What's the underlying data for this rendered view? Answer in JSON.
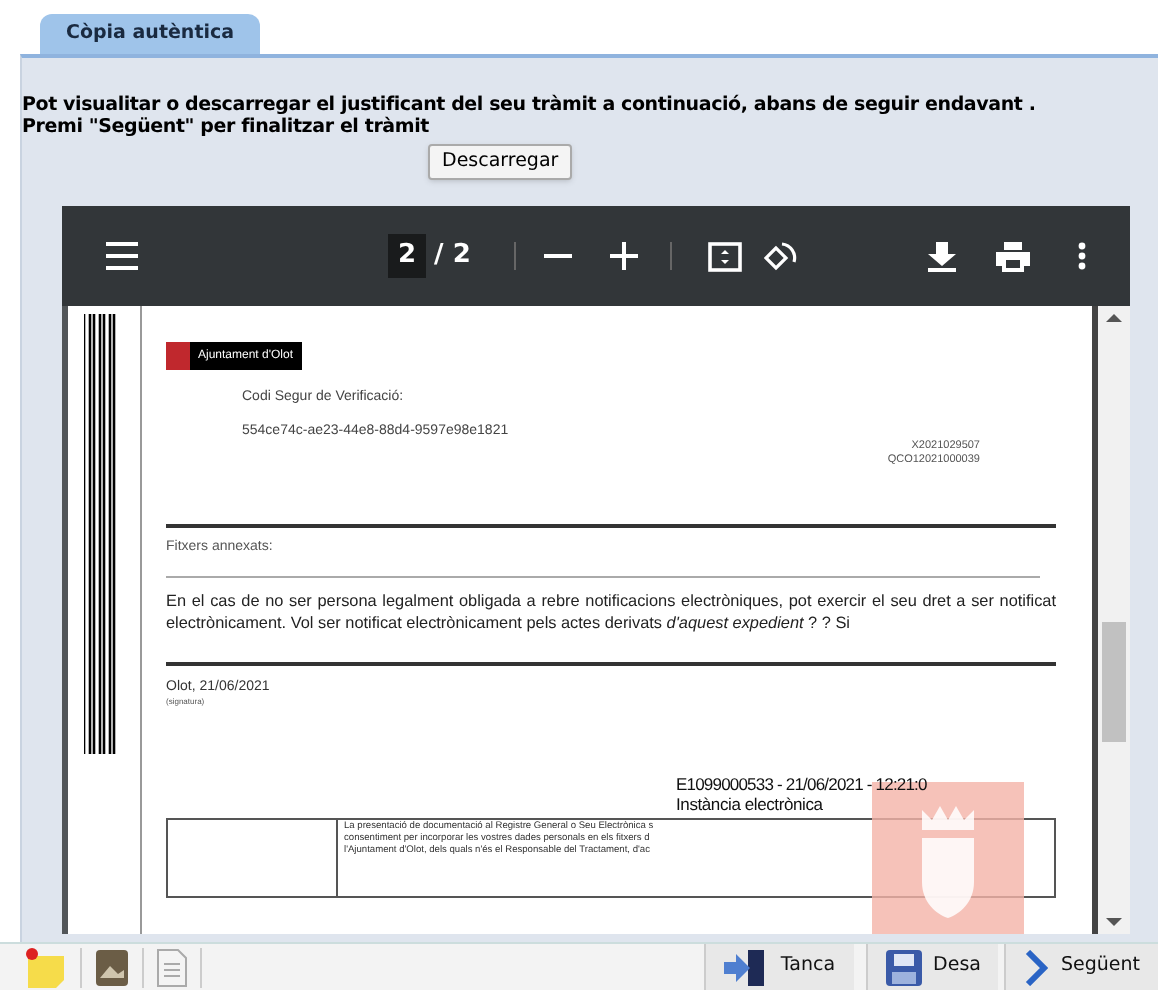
{
  "tabs": [
    {
      "label": "Còpia autèntica",
      "selected": true
    }
  ],
  "instructions": [
    "Pot visualitar o descarregar el justificant del seu tràmit a continuació, abans de seguir endavant .",
    "Premi \"Següent\" per finalitzar el tràmit"
  ],
  "download_button": "Descarregar",
  "pdf_viewer": {
    "page": "2",
    "page_count": "/ 2",
    "document": {
      "logo_text": "Ajuntament d'Olot",
      "csv_label": "Codi Segur de Verificació:",
      "csv_code": "554ce74c-ae23-44e8-88d4-9597e98e1821",
      "refs": [
        "X2021029507",
        "QCO12021000039"
      ],
      "attachments_label": "Fitxers  annexats:",
      "notice": "En el cas de no ser persona legalment obligada a rebre notificacions electròniques, pot exercir el seu dret a ser notificat electrònicament. Vol ser notificat electrònicament pels actes derivats *d'aquest expedient* ?  ?   Si",
      "place_date": "Olot,  21/06/2021",
      "signature_label": "(signatura)",
      "registry_line": "E1099000533 - 21/06/2021 - 12:21:0",
      "registry_type": "Instància electrònica",
      "privacy_lines": [
        "La presentació de documentació al Registre General o Seu Electrònica s",
        "consentiment per incorporar les vostres dades personals en els fitxers d",
        "l'Ajuntament d'Olot, dels quals n'és el Responsable del Tractament, d'ac"
      ]
    }
  },
  "bottom_buttons": [
    {
      "kind": "close",
      "label": "Tanca"
    },
    {
      "kind": "save",
      "label": "Desa"
    },
    {
      "kind": "next",
      "label": "Següent"
    }
  ]
}
